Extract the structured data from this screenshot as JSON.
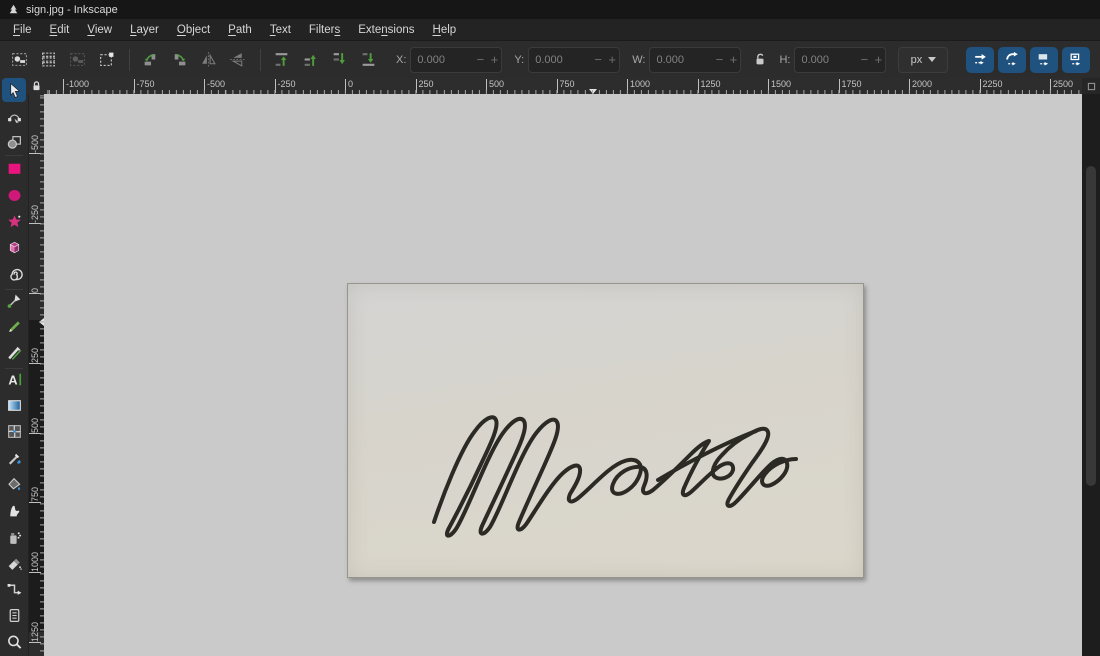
{
  "window": {
    "title": "sign.jpg - Inkscape"
  },
  "menubar": {
    "items": [
      {
        "label": "File",
        "mnemonic": 0
      },
      {
        "label": "Edit",
        "mnemonic": 0
      },
      {
        "label": "View",
        "mnemonic": 0
      },
      {
        "label": "Layer",
        "mnemonic": 0
      },
      {
        "label": "Object",
        "mnemonic": 0
      },
      {
        "label": "Path",
        "mnemonic": 0
      },
      {
        "label": "Text",
        "mnemonic": 0
      },
      {
        "label": "Filters",
        "mnemonic": 6
      },
      {
        "label": "Extensions",
        "mnemonic": 4
      },
      {
        "label": "Help",
        "mnemonic": 0
      }
    ]
  },
  "toolbar": {
    "select_buttons": [
      "select-all",
      "select-all-layers",
      "deselect",
      "selection-frame"
    ],
    "transform_buttons": [
      "rotate-ccw",
      "rotate-cw",
      "flip-horizontal",
      "flip-vertical"
    ],
    "zorder_buttons": [
      "raise-to-top",
      "raise",
      "lower",
      "lower-to-bottom"
    ],
    "fields": [
      {
        "label": "X:",
        "value": "0.000"
      },
      {
        "label": "Y:",
        "value": "0.000"
      },
      {
        "label": "W:",
        "value": "0.000"
      },
      {
        "label": "H:",
        "value": "0.000"
      }
    ],
    "lock_state": "unlocked",
    "unit": "px",
    "scale_toggles": [
      "scale-stroke",
      "scale-corners",
      "scale-gradient",
      "scale-pattern"
    ]
  },
  "toolbox": {
    "active": "selector",
    "tools": [
      "selector",
      "node-editor",
      "shape-builder",
      "rectangle",
      "ellipse",
      "star",
      "box-3d",
      "spiral",
      "pen",
      "pencil",
      "calligraphy",
      "text",
      "gradient",
      "mesh-gradient",
      "dropper",
      "paint-bucket",
      "tweak",
      "spray",
      "eraser",
      "connector",
      "pages",
      "zoom"
    ]
  },
  "rulers": {
    "horizontal_labels": [
      "-1000",
      "-750",
      "-500",
      "-250",
      "0",
      "250",
      "500",
      "750",
      "1000",
      "1250",
      "1500",
      "1750",
      "2000",
      "2250",
      "2500"
    ],
    "vertical_labels": [
      "-500",
      "-250",
      "0",
      "250",
      "500",
      "750",
      "1000",
      "1250"
    ]
  },
  "canvas": {
    "signature_transcription": "Uunatek",
    "signature": {
      "stroke_color": "#2c2a24",
      "stroke_width": 4,
      "paths": [
        "M 86 238 C 94 214 112 166 127 147 C 135 136 145 129 148 136 C 151 143 142 161 134 178 C 122 204 108 231 101 244 C 96 253 101 255 108 245 C 120 226 139 171 155 149 C 163 138 172 131 176 137 C 180 144 171 163 163 180 C 152 204 140 229 134 242 C 130 251 135 253 142 243 C 154 223 172 169 189 148 C 197 138 206 132 209 138 C 213 145 204 164 196 182 C 186 204 176 226 171 238 C 167 247 172 249 179 239 C 189 224 203 200 215 189 C 224 181 231 179 232 185 C 233 192 227 202 222 210 C 219 217 222 220 229 215 C 238 208 249 196 260 187 C 272 177 285 172 291 179 C 296 185 290 199 280 206 C 270 213 261 210 265 200 C 269 189 282 182 292 183 C 300 184 300 193 296 202 C 293 209 297 212 305 206 C 317 196 330 183 342 171 C 350 163 357 158 361 157 C 353 169 342 190 336 204 C 333 211 336 214 343 208 C 352 200 363 188 372 182 C 380 177 386 179 385 186 C 383 193 373 197 367 193 C 362 189 366 179 374 171 C 382 162 392 155 400 151 C 410 145 418 142 420 148 C 422 154 413 167 404 179 C 395 192 386 206 381 215 C 377 222 381 225 388 218 C 398 208 410 193 420 183 C 429 174 437 172 439 179 C 441 187 432 197 423 201 C 415 204 411 198 417 190 C 424 181 437 175 448 175",
        "M 310 196 C 335 181 374 160 408 147"
      ]
    }
  },
  "colors": {
    "accent_blue": "#1f527f",
    "desk": "#cacaca",
    "paper": "#d8d5cc",
    "chrome_bg": "#2c2c2c"
  }
}
